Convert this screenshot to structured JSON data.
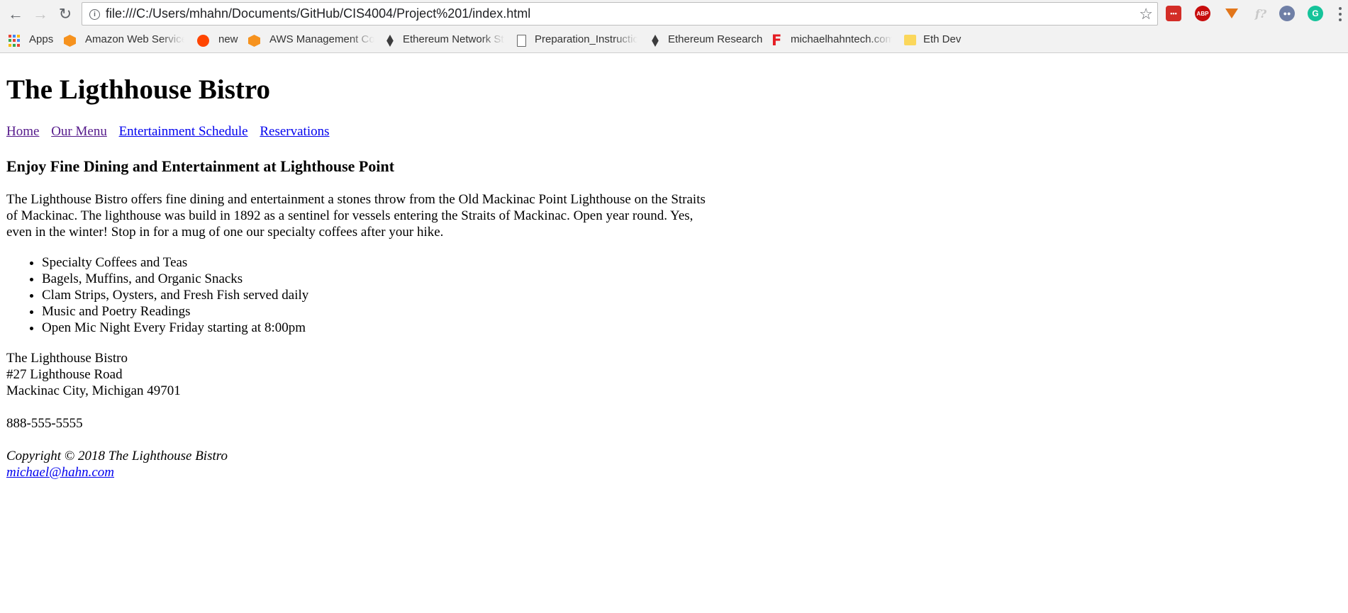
{
  "browser": {
    "url": "file:///C:/Users/mhahn/Documents/GitHub/CIS4004/Project%201/index.html",
    "bookmarks": [
      {
        "label": "Apps",
        "icon": "apps-grid-icon"
      },
      {
        "label": "Amazon Web Service",
        "icon": "aws-hexagon-icon"
      },
      {
        "label": "new",
        "icon": "reddit-icon"
      },
      {
        "label": "AWS Management Co",
        "icon": "aws-hexagon-icon"
      },
      {
        "label": "Ethereum Network St",
        "icon": "ethereum-icon"
      },
      {
        "label": "Preparation_Instructio",
        "icon": "document-icon"
      },
      {
        "label": "Ethereum Research",
        "icon": "ethereum-icon"
      },
      {
        "label": "michaelhahntech.com",
        "icon": "f-letter-icon"
      },
      {
        "label": "Eth Dev",
        "icon": "folder-icon"
      }
    ],
    "extensions": [
      "lastpass-icon",
      "adblock-plus-icon",
      "metamask-fox-icon",
      "formula-icon",
      "spy-icon",
      "grammarly-icon"
    ],
    "extension_text": {
      "lastpass": "•••",
      "abp": "ABP",
      "formula": "f?",
      "grammarly": "G"
    }
  },
  "page": {
    "title": "The Ligthhouse Bistro",
    "nav": [
      {
        "label": "Home",
        "state": "visited"
      },
      {
        "label": "Our Menu",
        "state": "visited"
      },
      {
        "label": "Entertainment Schedule",
        "state": "link"
      },
      {
        "label": "Reservations",
        "state": "link"
      }
    ],
    "heading": "Enjoy Fine Dining and Entertainment at Lighthouse Point",
    "intro": "The Lighthouse Bistro offers fine dining and entertainment a stones throw from the Old Mackinac Point Lighthouse on the Straits of Mackinac. The lighthouse was build in 1892 as a sentinel for vessels entering the Straits of Mackinac. Open year round. Yes, even in the winter! Stop in for a mug of one our specialty coffees after your hike.",
    "features": [
      "Specialty Coffees and Teas",
      "Bagels, Muffins, and Organic Snacks",
      "Clam Strips, Oysters, and Fresh Fish served daily",
      "Music and Poetry Readings",
      "Open Mic Night Every Friday starting at 8:00pm"
    ],
    "address": {
      "name": "The Lighthouse Bistro",
      "street": "#27 Lighthouse Road",
      "city": "Mackinac City, Michigan 49701"
    },
    "phone": "888-555-5555",
    "footer": {
      "copyright": "Copyright © 2018 The Lighthouse Bistro",
      "email": "michael@hahn.com"
    }
  },
  "colors": {
    "link": "#0000ee",
    "visited_link": "#551a8b",
    "chrome_bg": "#f2f2f2"
  }
}
